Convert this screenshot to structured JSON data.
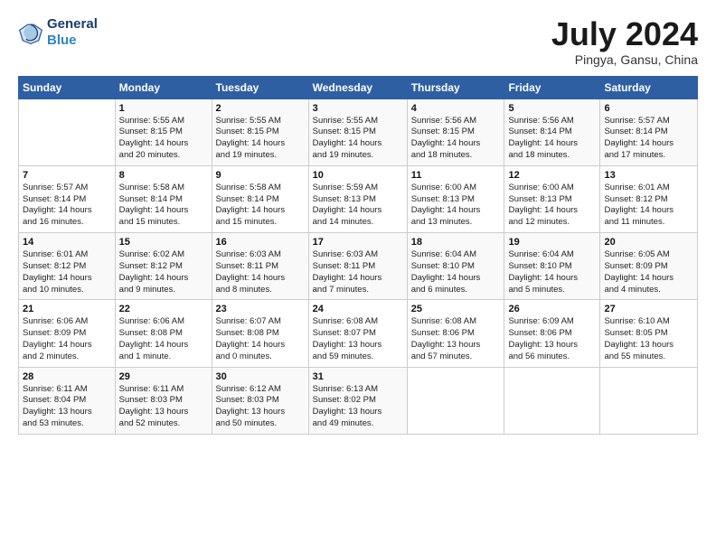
{
  "header": {
    "logo_line1": "General",
    "logo_line2": "Blue",
    "month": "July 2024",
    "location": "Pingya, Gansu, China"
  },
  "weekdays": [
    "Sunday",
    "Monday",
    "Tuesday",
    "Wednesday",
    "Thursday",
    "Friday",
    "Saturday"
  ],
  "weeks": [
    [
      {
        "day": "",
        "info": ""
      },
      {
        "day": "1",
        "info": "Sunrise: 5:55 AM\nSunset: 8:15 PM\nDaylight: 14 hours\nand 20 minutes."
      },
      {
        "day": "2",
        "info": "Sunrise: 5:55 AM\nSunset: 8:15 PM\nDaylight: 14 hours\nand 19 minutes."
      },
      {
        "day": "3",
        "info": "Sunrise: 5:55 AM\nSunset: 8:15 PM\nDaylight: 14 hours\nand 19 minutes."
      },
      {
        "day": "4",
        "info": "Sunrise: 5:56 AM\nSunset: 8:15 PM\nDaylight: 14 hours\nand 18 minutes."
      },
      {
        "day": "5",
        "info": "Sunrise: 5:56 AM\nSunset: 8:14 PM\nDaylight: 14 hours\nand 18 minutes."
      },
      {
        "day": "6",
        "info": "Sunrise: 5:57 AM\nSunset: 8:14 PM\nDaylight: 14 hours\nand 17 minutes."
      }
    ],
    [
      {
        "day": "7",
        "info": "Sunrise: 5:57 AM\nSunset: 8:14 PM\nDaylight: 14 hours\nand 16 minutes."
      },
      {
        "day": "8",
        "info": "Sunrise: 5:58 AM\nSunset: 8:14 PM\nDaylight: 14 hours\nand 15 minutes."
      },
      {
        "day": "9",
        "info": "Sunrise: 5:58 AM\nSunset: 8:14 PM\nDaylight: 14 hours\nand 15 minutes."
      },
      {
        "day": "10",
        "info": "Sunrise: 5:59 AM\nSunset: 8:13 PM\nDaylight: 14 hours\nand 14 minutes."
      },
      {
        "day": "11",
        "info": "Sunrise: 6:00 AM\nSunset: 8:13 PM\nDaylight: 14 hours\nand 13 minutes."
      },
      {
        "day": "12",
        "info": "Sunrise: 6:00 AM\nSunset: 8:13 PM\nDaylight: 14 hours\nand 12 minutes."
      },
      {
        "day": "13",
        "info": "Sunrise: 6:01 AM\nSunset: 8:12 PM\nDaylight: 14 hours\nand 11 minutes."
      }
    ],
    [
      {
        "day": "14",
        "info": "Sunrise: 6:01 AM\nSunset: 8:12 PM\nDaylight: 14 hours\nand 10 minutes."
      },
      {
        "day": "15",
        "info": "Sunrise: 6:02 AM\nSunset: 8:12 PM\nDaylight: 14 hours\nand 9 minutes."
      },
      {
        "day": "16",
        "info": "Sunrise: 6:03 AM\nSunset: 8:11 PM\nDaylight: 14 hours\nand 8 minutes."
      },
      {
        "day": "17",
        "info": "Sunrise: 6:03 AM\nSunset: 8:11 PM\nDaylight: 14 hours\nand 7 minutes."
      },
      {
        "day": "18",
        "info": "Sunrise: 6:04 AM\nSunset: 8:10 PM\nDaylight: 14 hours\nand 6 minutes."
      },
      {
        "day": "19",
        "info": "Sunrise: 6:04 AM\nSunset: 8:10 PM\nDaylight: 14 hours\nand 5 minutes."
      },
      {
        "day": "20",
        "info": "Sunrise: 6:05 AM\nSunset: 8:09 PM\nDaylight: 14 hours\nand 4 minutes."
      }
    ],
    [
      {
        "day": "21",
        "info": "Sunrise: 6:06 AM\nSunset: 8:09 PM\nDaylight: 14 hours\nand 2 minutes."
      },
      {
        "day": "22",
        "info": "Sunrise: 6:06 AM\nSunset: 8:08 PM\nDaylight: 14 hours\nand 1 minute."
      },
      {
        "day": "23",
        "info": "Sunrise: 6:07 AM\nSunset: 8:08 PM\nDaylight: 14 hours\nand 0 minutes."
      },
      {
        "day": "24",
        "info": "Sunrise: 6:08 AM\nSunset: 8:07 PM\nDaylight: 13 hours\nand 59 minutes."
      },
      {
        "day": "25",
        "info": "Sunrise: 6:08 AM\nSunset: 8:06 PM\nDaylight: 13 hours\nand 57 minutes."
      },
      {
        "day": "26",
        "info": "Sunrise: 6:09 AM\nSunset: 8:06 PM\nDaylight: 13 hours\nand 56 minutes."
      },
      {
        "day": "27",
        "info": "Sunrise: 6:10 AM\nSunset: 8:05 PM\nDaylight: 13 hours\nand 55 minutes."
      }
    ],
    [
      {
        "day": "28",
        "info": "Sunrise: 6:11 AM\nSunset: 8:04 PM\nDaylight: 13 hours\nand 53 minutes."
      },
      {
        "day": "29",
        "info": "Sunrise: 6:11 AM\nSunset: 8:03 PM\nDaylight: 13 hours\nand 52 minutes."
      },
      {
        "day": "30",
        "info": "Sunrise: 6:12 AM\nSunset: 8:03 PM\nDaylight: 13 hours\nand 50 minutes."
      },
      {
        "day": "31",
        "info": "Sunrise: 6:13 AM\nSunset: 8:02 PM\nDaylight: 13 hours\nand 49 minutes."
      },
      {
        "day": "",
        "info": ""
      },
      {
        "day": "",
        "info": ""
      },
      {
        "day": "",
        "info": ""
      }
    ]
  ]
}
